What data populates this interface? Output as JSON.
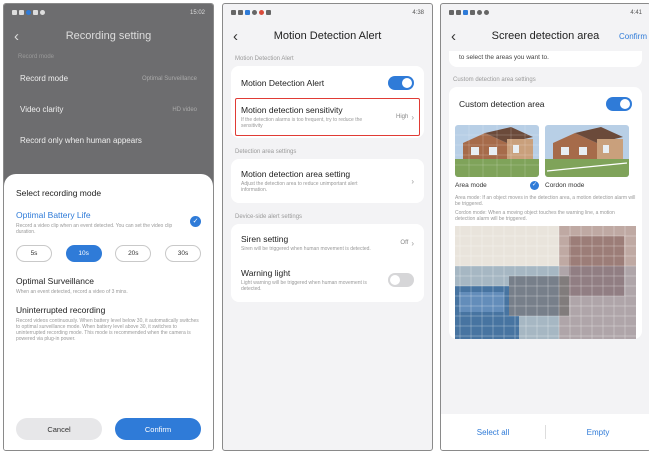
{
  "screen1": {
    "status": {
      "time": "15:02"
    },
    "bg": {
      "title": "Recording setting",
      "section": "Record mode",
      "rows": [
        {
          "label": "Record mode",
          "value": "Optimal Surveillance"
        },
        {
          "label": "Video clarity",
          "value": "HD video"
        },
        {
          "label": "Record only when human appears",
          "value": ""
        }
      ]
    },
    "sheet": {
      "title": "Select recording mode",
      "options": [
        {
          "title": "Optimal Battery Life",
          "desc": "Record a video clip when an event detected. You can set the video clip duration."
        },
        {
          "title": "Optimal Surveillance",
          "desc": "When an event detected, record a video of 3 mins."
        },
        {
          "title": "Uninterrupted recording",
          "desc": "Record videos continuously. When battery level below 30, it automatically switches to optimal surveillance mode. When battery level above 30, it switches to uninterrupted recording mode. This mode is recommended when the camera is powered via plug-in power."
        }
      ],
      "durations": [
        "5s",
        "10s",
        "20s",
        "30s"
      ],
      "selected_duration": "10s",
      "cancel": "Cancel",
      "confirm": "Confirm"
    }
  },
  "screen2": {
    "status": {
      "time": "4:38"
    },
    "title": "Motion Detection Alert",
    "section1": "Motion Detection Alert",
    "alert_label": "Motion Detection Alert",
    "sensitivity": {
      "title": "Motion detection sensitivity",
      "desc": "If the detection alarms is too frequent, try to reduce the sensitivity",
      "value": "High"
    },
    "section2": "Detection area settings",
    "area": {
      "title": "Motion detection area setting",
      "desc": "Adjust the detection area to reduce unimportant alert information."
    },
    "section3": "Device-side alert settings",
    "siren": {
      "title": "Siren setting",
      "desc": "Siren will be triggered when human movement is detected.",
      "value": "Off"
    },
    "warning": {
      "title": "Warning light",
      "desc": "Light warning will be triggered when human movement is detected."
    }
  },
  "screen3": {
    "status": {
      "time": "4:41"
    },
    "title": "Screen detection area",
    "confirm": "Confirm",
    "top_text": "to select the areas you want to.",
    "section": "Custom detection area settings",
    "custom_label": "Custom detection area",
    "area_mode": "Area mode",
    "cordon_mode": "Cordon mode",
    "desc1": "Area mode: If an object moves in the detection area, a motion detection alarm will be triggered.",
    "desc2": "Cordon mode: When a moving object touches the warning line, a motion detection alarm will be triggered.",
    "select_all": "Select all",
    "empty": "Empty"
  }
}
